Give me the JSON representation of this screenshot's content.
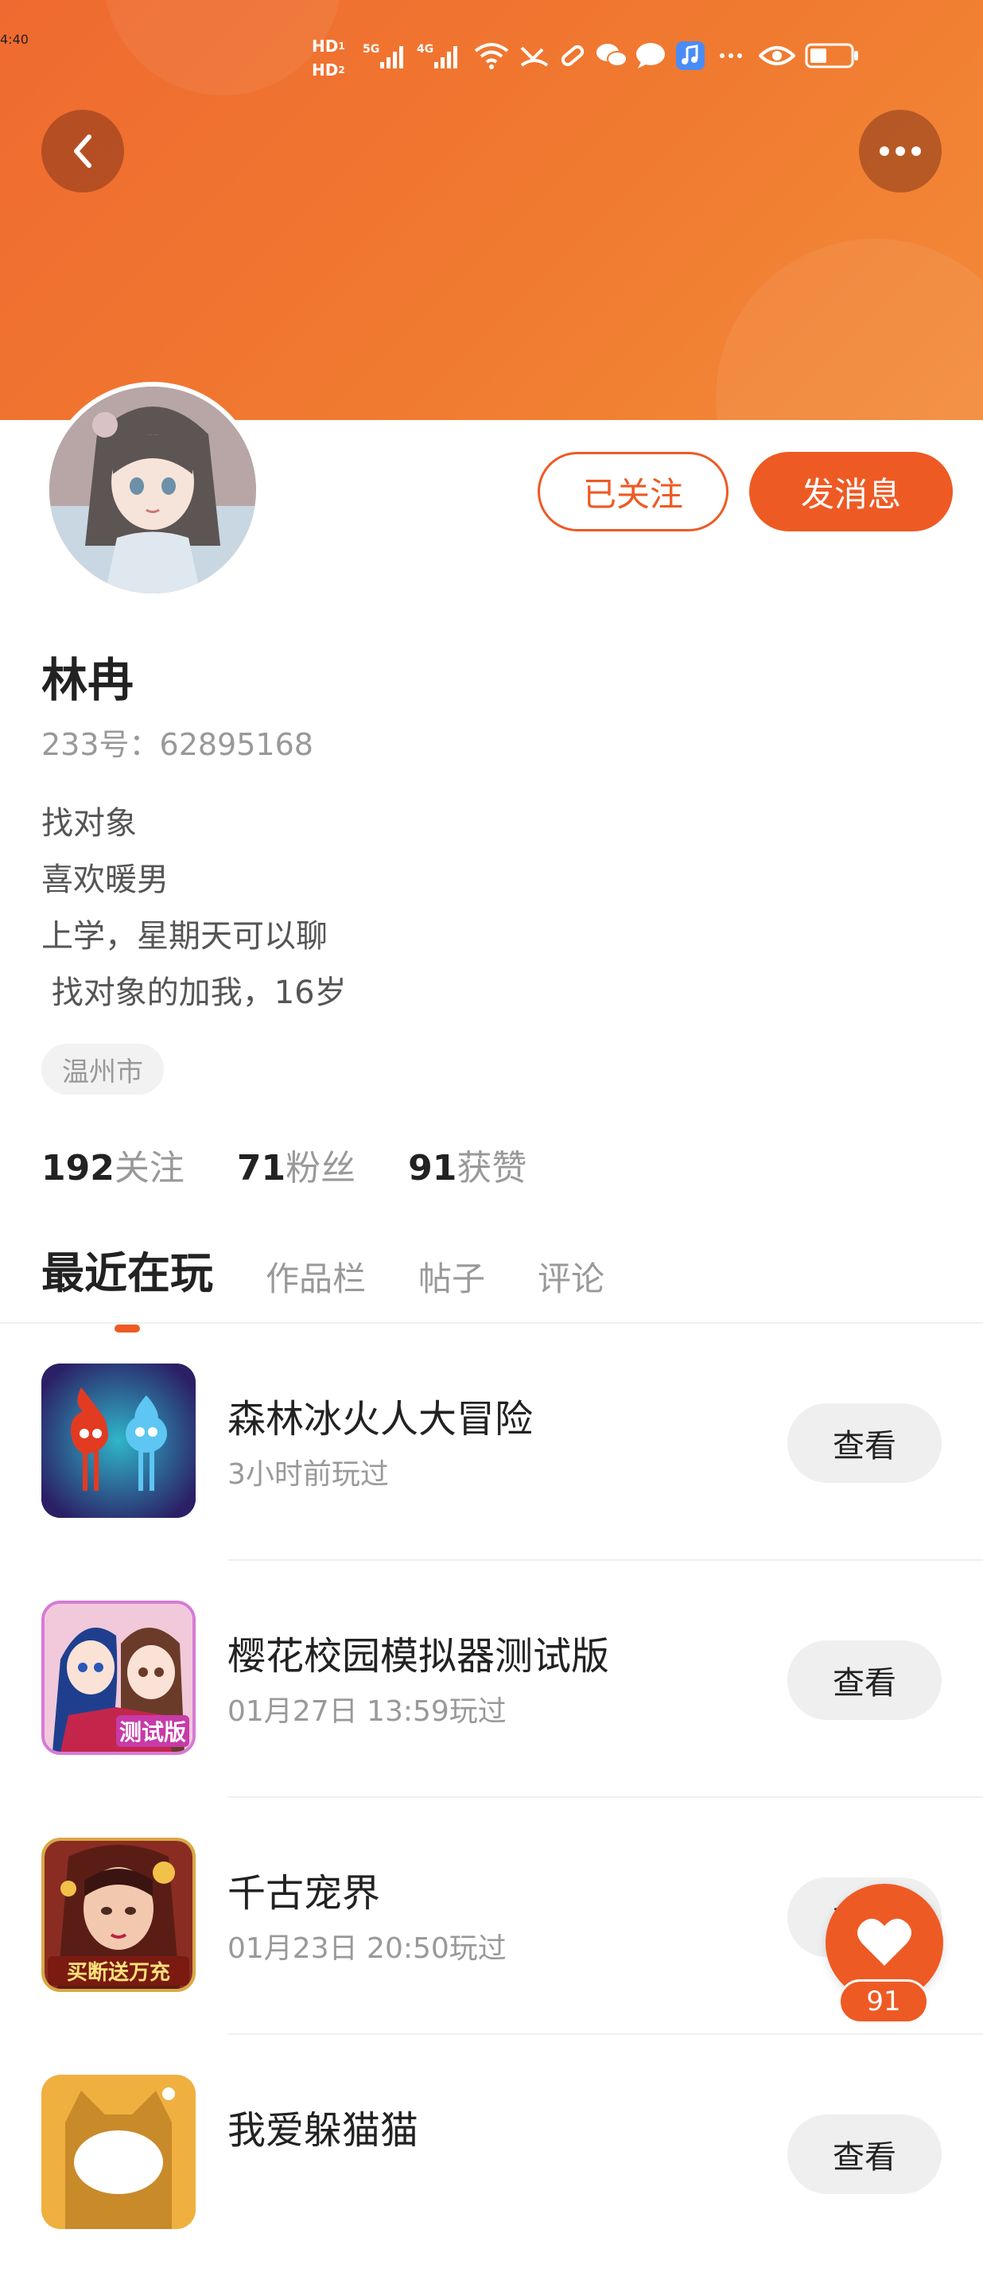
{
  "status_bar": {
    "time": "4:40",
    "icons": [
      "hd-1-icon",
      "hd-2-icon",
      "signal-5g-icon",
      "signal-4g-icon",
      "wifi-icon",
      "missed-call-icon",
      "bandage-icon",
      "wechat-icon",
      "chat-bubble-icon",
      "music-app-icon",
      "more-dots-icon",
      "eye-icon",
      "battery-icon"
    ]
  },
  "nav": {
    "back_icon": "back-arrow-icon",
    "more_icon": "more-horizontal-icon"
  },
  "profile": {
    "followed_label": "已关注",
    "message_label": "发消息",
    "name": "林冉",
    "uid": "233号：62895168",
    "bio": [
      "找对象",
      "喜欢暖男",
      "上学，星期天可以聊",
      " 找对象的加我，16岁"
    ],
    "location": "温州市"
  },
  "stats": [
    {
      "num": "192",
      "label": "关注"
    },
    {
      "num": "71",
      "label": "粉丝"
    },
    {
      "num": "91",
      "label": "获赞"
    }
  ],
  "tabs": [
    "最近在玩",
    "作品栏",
    "帖子",
    "评论"
  ],
  "games": [
    {
      "title": "森林冰火人大冒险",
      "sub": "3小时前玩过",
      "btn": "查看"
    },
    {
      "title": "樱花校园模拟器测试版",
      "sub": "01月27日 13:59玩过",
      "btn": "查看",
      "badge": "测试版"
    },
    {
      "title": "千古宠界",
      "sub": "01月23日 20:50玩过",
      "btn": "查看",
      "badge": "买断送万充"
    },
    {
      "title": "我爱躲猫猫",
      "sub": "",
      "btn": "查看"
    }
  ],
  "fab": {
    "count": "91"
  },
  "colors": {
    "accent": "#ee5a24",
    "header": "#f07a30"
  }
}
